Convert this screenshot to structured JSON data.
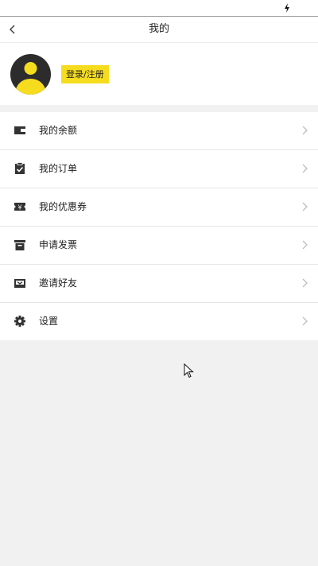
{
  "header": {
    "title": "我的"
  },
  "profile": {
    "login_label": "登录/注册"
  },
  "menu": [
    {
      "label": "我的余额",
      "icon": "wallet-icon"
    },
    {
      "label": "我的订单",
      "icon": "clipboard-check-icon"
    },
    {
      "label": "我的优惠券",
      "icon": "coupon-icon"
    },
    {
      "label": "申请发票",
      "icon": "invoice-icon"
    },
    {
      "label": "邀请好友",
      "icon": "invite-mail-icon"
    },
    {
      "label": "设置",
      "icon": "gear-icon"
    }
  ],
  "colors": {
    "accent": "#f6dc1e",
    "avatar_bg": "#2c2c2c",
    "page_bg": "#f0f1f0",
    "icon": "#333333"
  }
}
